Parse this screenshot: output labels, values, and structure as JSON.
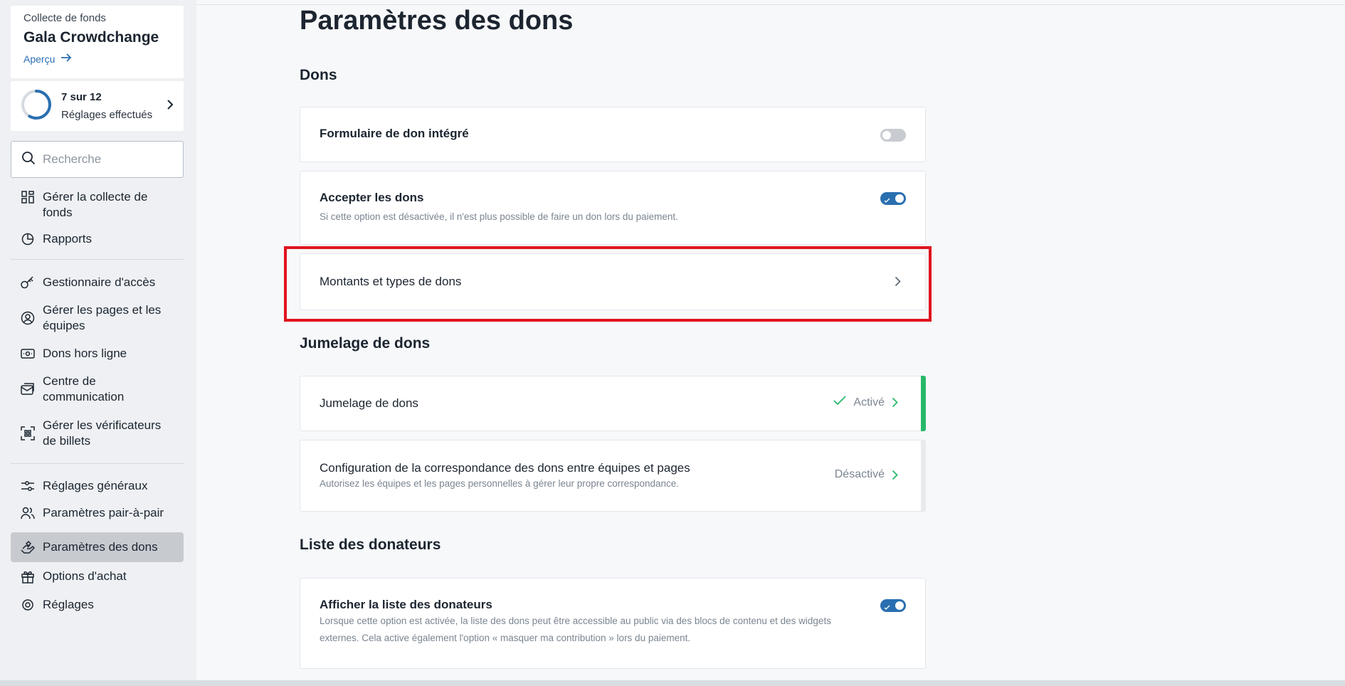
{
  "sidebar": {
    "fund": {
      "eyebrow": "Collecte de fonds",
      "title": "Gala Crowdchange",
      "preview_link": "Aperçu"
    },
    "progress": {
      "count": "7 sur 12",
      "label": "Réglages effectués",
      "completed": 7,
      "total": 12
    },
    "search": {
      "placeholder": "Recherche"
    },
    "nav": [
      {
        "label": "Gérer la collecte de fonds",
        "icon": "dashboard-icon"
      },
      {
        "label": "Rapports",
        "icon": "pie-chart-icon"
      },
      {
        "label": "Gestionnaire d'accès",
        "icon": "key-icon"
      },
      {
        "label": "Gérer les pages et les équipes",
        "icon": "user-circle-icon"
      },
      {
        "label": "Dons hors ligne",
        "icon": "cash-icon"
      },
      {
        "label": "Centre de communication",
        "icon": "mail-icon"
      },
      {
        "label": "Gérer les vérificateurs de billets",
        "icon": "qr-scan-icon"
      },
      {
        "label": "Réglages généraux",
        "icon": "sliders-icon"
      },
      {
        "label": "Paramètres pair-à-pair",
        "icon": "users-icon"
      },
      {
        "label": "Paramètres des dons",
        "icon": "donation-hand-icon",
        "active": true
      },
      {
        "label": "Options d'achat",
        "icon": "gift-icon"
      },
      {
        "label": "Réglages",
        "icon": "settings-icon"
      }
    ]
  },
  "main": {
    "title": "Paramètres des dons",
    "sections": {
      "dons": "Dons",
      "jumelage": "Jumelage de dons",
      "donateurs": "Liste des donateurs"
    },
    "cards": {
      "integrated_form": {
        "title": "Formulaire de don intégré",
        "toggle": false
      },
      "accept": {
        "title": "Accepter les dons",
        "desc": "Si cette option est désactivée, il n'est plus possible de faire un don lors du paiement.",
        "toggle": true
      },
      "amounts": {
        "title": "Montants et types de dons"
      },
      "matching": {
        "title": "Jumelage de dons",
        "status": "Activé"
      },
      "matching_config": {
        "title": "Configuration de la correspondance des dons entre équipes et pages",
        "desc": "Autorisez les équipes et les pages personnelles à gérer leur propre correspondance.",
        "status": "Désactivé"
      },
      "donor_list": {
        "title": "Afficher la liste des donateurs",
        "desc": "Lorsque cette option est activée, la liste des dons peut être accessible au public via des blocs de contenu et des widgets externes. Cela active également l'option « masquer ma contribution » lors du paiement.",
        "toggle": true
      }
    }
  },
  "colors": {
    "accent": "#2a6fb0",
    "success": "#27b86a",
    "highlight": "#e0141e"
  }
}
